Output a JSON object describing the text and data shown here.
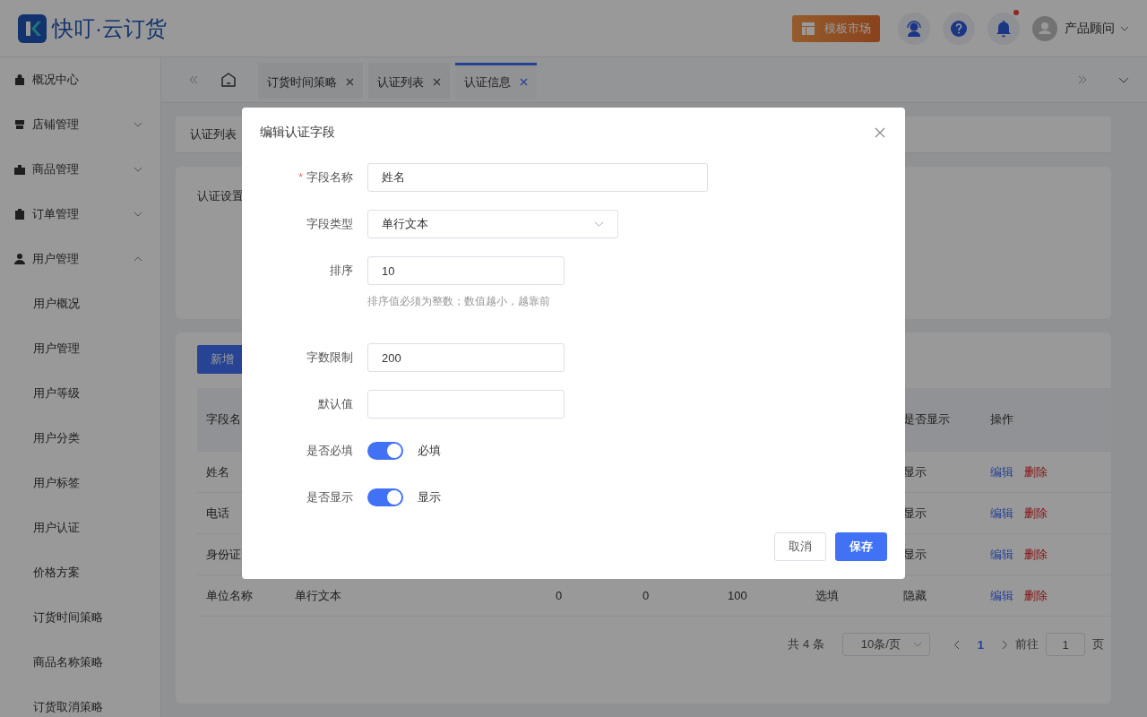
{
  "header": {
    "logo_text": "快叮·云订货",
    "market_button": "模板市场",
    "notification_dot": true,
    "user_name": "产品顾问"
  },
  "sidebar": {
    "items": [
      {
        "label": "概况中心"
      },
      {
        "label": "店铺管理",
        "expanded": false
      },
      {
        "label": "商品管理",
        "expanded": false
      },
      {
        "label": "订单管理",
        "expanded": false
      },
      {
        "label": "用户管理",
        "expanded": true,
        "children": [
          {
            "label": "用户概况"
          },
          {
            "label": "用户管理"
          },
          {
            "label": "用户等级"
          },
          {
            "label": "用户分类"
          },
          {
            "label": "用户标签"
          },
          {
            "label": "用户认证"
          },
          {
            "label": "价格方案"
          },
          {
            "label": "订货时间策略"
          },
          {
            "label": "商品名称策略"
          },
          {
            "label": "订货取消策略"
          }
        ]
      }
    ]
  },
  "tabs": [
    {
      "label": "订货时间策略",
      "selected": false
    },
    {
      "label": "认证列表",
      "selected": false
    },
    {
      "label": "认证信息",
      "selected": true
    }
  ],
  "breadcrumb": "认证列表",
  "settings_label": "认证设置",
  "add_button": "新增",
  "table": {
    "columns": {
      "name": "字段名",
      "display": "是否显示",
      "actions": "操作"
    },
    "rows": [
      {
        "name": "姓名",
        "display": "显示",
        "edit": "编辑",
        "delete": "删除"
      },
      {
        "name": "电话",
        "display": "显示",
        "edit": "编辑",
        "delete": "删除"
      },
      {
        "name": "身份证",
        "display": "显示",
        "edit": "编辑",
        "delete": "删除"
      },
      {
        "name": "单位名称",
        "type": "单行文本",
        "col_3": "0",
        "col_4": "0",
        "col_5": "100",
        "required": "选填",
        "display": "隐藏",
        "edit": "编辑",
        "delete": "删除"
      }
    ]
  },
  "pagination": {
    "total": "共 4 条",
    "page_size": "10条/页",
    "pages": [
      {
        "label": "1",
        "selected": true
      }
    ],
    "goto_prefix": "前往",
    "goto_value": "1",
    "goto_suffix": "页"
  },
  "dialog": {
    "title": "编辑认证字段",
    "fields": [
      {
        "kind": "input",
        "label": "字段名称",
        "required_mark": "*",
        "value": "姓名"
      },
      {
        "kind": "select",
        "label": "字段类型",
        "value": "单行文本"
      },
      {
        "kind": "input",
        "label": "排序",
        "value": "10",
        "hint": "排序值必须为整数；数值越小，越靠前"
      },
      {
        "kind": "input",
        "label": "字数限制",
        "value": "200"
      },
      {
        "kind": "input",
        "label": "默认值"
      },
      {
        "kind": "switch",
        "label": "是否必填",
        "on": true,
        "text": "必填"
      },
      {
        "kind": "switch",
        "label": "是否显示",
        "on": true,
        "text": "显示"
      }
    ],
    "buttons": [
      {
        "label": "取消",
        "kind": "default"
      },
      {
        "label": "保存",
        "kind": "primary"
      }
    ]
  }
}
